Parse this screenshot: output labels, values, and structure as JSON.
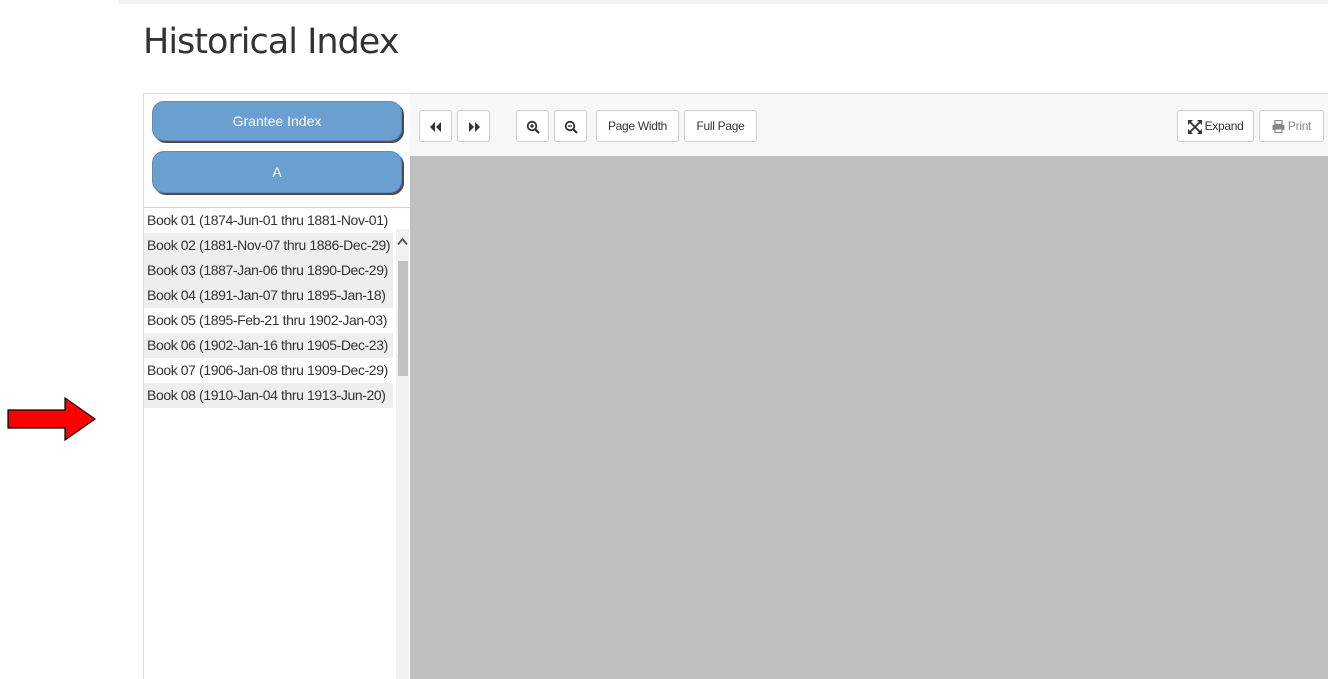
{
  "page": {
    "title": "Historical Index"
  },
  "left_panel": {
    "index_type_label": "Grantee Index",
    "letter_label": "A",
    "books": [
      {
        "label": "Book 01 (1874-Jun-01 thru 1881-Nov-01)"
      },
      {
        "label": "Book 02 (1881-Nov-07 thru 1886-Dec-29)"
      },
      {
        "label": "Book 03 (1887-Jan-06 thru 1890-Dec-29)"
      },
      {
        "label": "Book 04 (1891-Jan-07 thru 1895-Jan-18)"
      },
      {
        "label": "Book 05 (1895-Feb-21 thru 1902-Jan-03)"
      },
      {
        "label": "Book 06 (1902-Jan-16 thru 1905-Dec-23)"
      },
      {
        "label": "Book 07 (1906-Jan-08 thru 1909-Dec-29)"
      },
      {
        "label": "Book 08 (1910-Jan-04 thru 1913-Jun-20)"
      }
    ]
  },
  "toolbar": {
    "page_width_label": "Page Width",
    "full_page_label": "Full Page",
    "expand_label": "Expand",
    "print_label": "Print",
    "icons": {
      "prev": "double-left-icon",
      "next": "double-right-icon",
      "zoom_in": "zoom-in-icon",
      "zoom_out": "zoom-out-icon",
      "expand": "expand-icon",
      "print": "print-icon"
    }
  },
  "colors": {
    "pill_button": "#6a9fcf",
    "viewer_background": "#bfbfbf",
    "arrow": "#ff0000"
  }
}
